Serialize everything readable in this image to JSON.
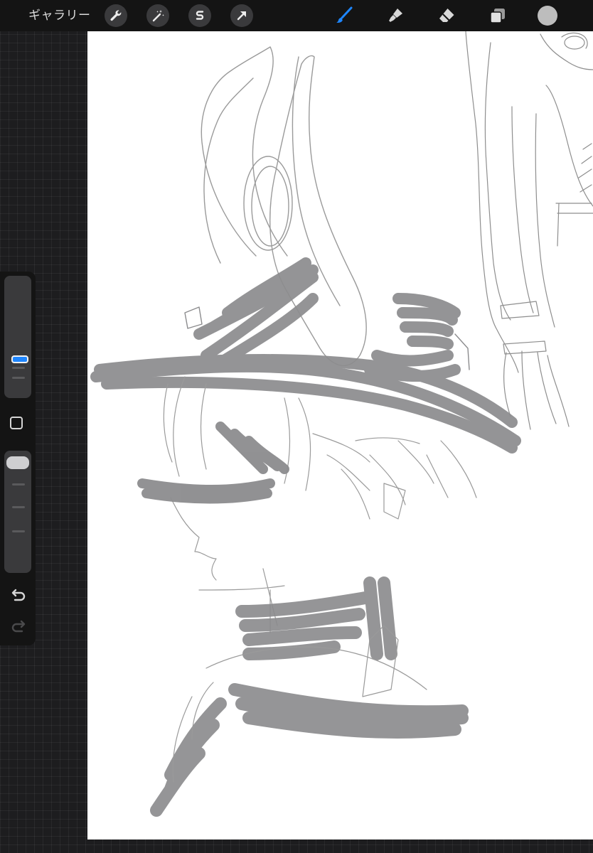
{
  "topbar": {
    "gallery_label": "ギャラリー",
    "left_tools": [
      "wrench-icon",
      "magic-wand-icon",
      "selection-s-icon",
      "transform-arrow-icon"
    ],
    "right_tools": [
      "brush-icon",
      "smudge-icon",
      "eraser-icon",
      "layers-icon"
    ],
    "active_tool": "brush",
    "accent_color": "#1e86ff",
    "current_color": "#bdbdbd"
  },
  "sidebar": {
    "controls": [
      "brush-size-slider",
      "modify-button",
      "opacity-slider",
      "undo-icon",
      "redo-icon"
    ]
  },
  "canvas": {
    "background": "#ffffff",
    "stroke_color": "#9a9a9c"
  }
}
